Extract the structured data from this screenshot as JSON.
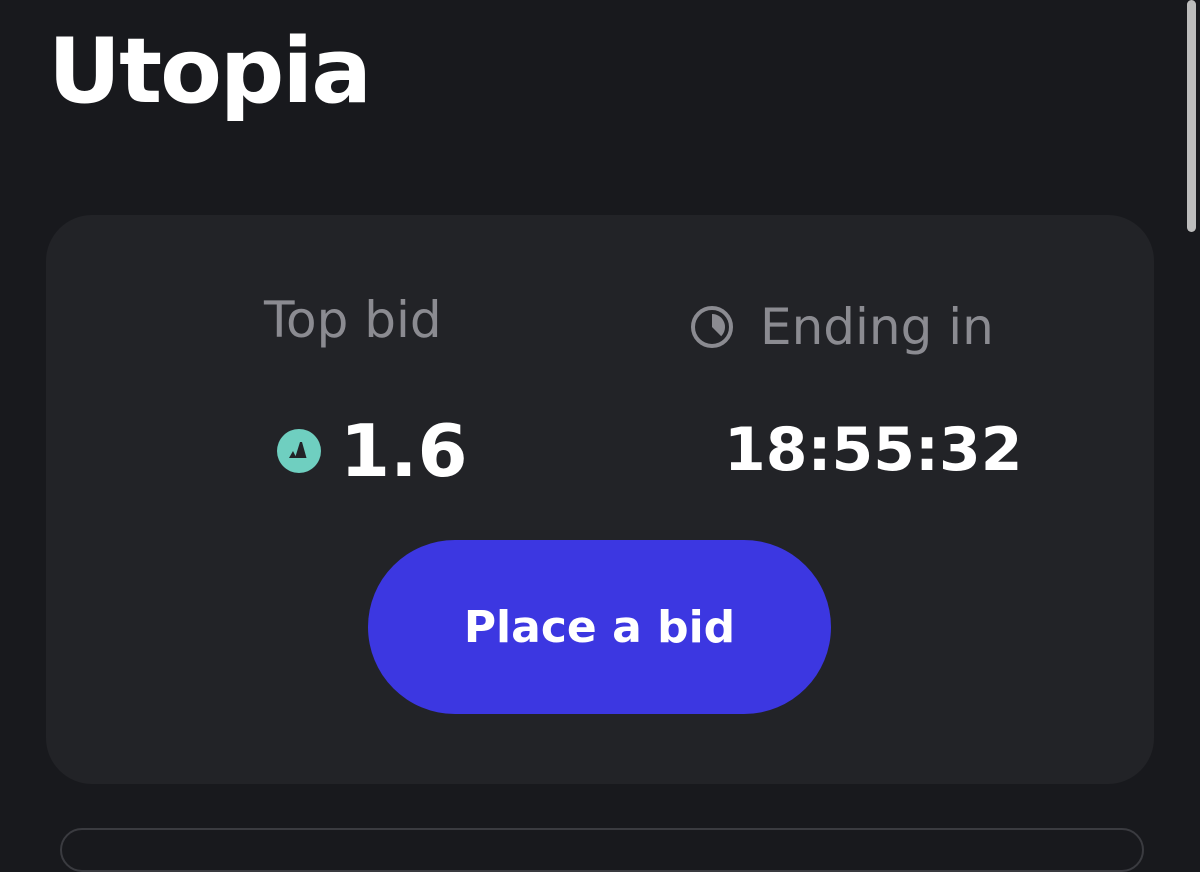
{
  "page": {
    "title": "Utopia"
  },
  "auction": {
    "top_bid_label": "Top bid",
    "top_bid_value": "1.6",
    "currency_icon": "avalanche-icon",
    "ending_label": "Ending in",
    "ending_icon": "clock-icon",
    "countdown": "18:55:32",
    "bid_button_label": "Place a bid"
  },
  "colors": {
    "background": "#18191d",
    "card": "#222327",
    "accent": "#3c37e1",
    "avax_icon": "#6fcfc0",
    "muted_text": "#8b8b91"
  }
}
